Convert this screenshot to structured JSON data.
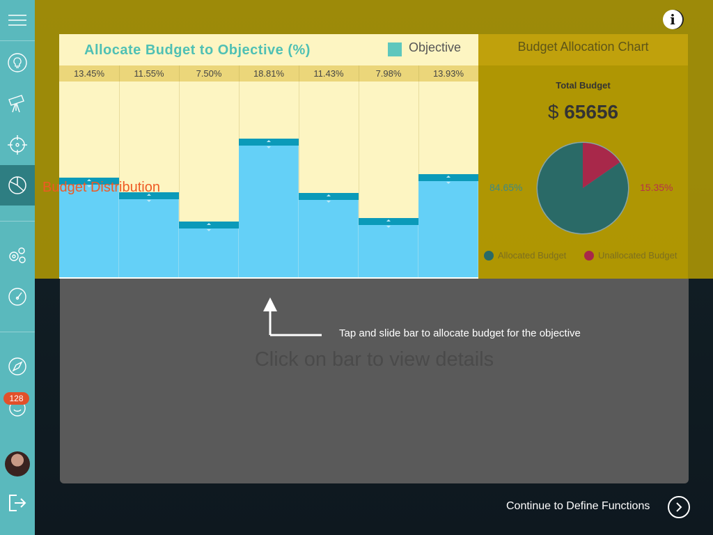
{
  "sidebar": {
    "items": [
      {
        "icon": "menu-icon"
      },
      {
        "icon": "lightbulb-icon"
      },
      {
        "icon": "telescope-icon"
      },
      {
        "icon": "target-icon"
      },
      {
        "icon": "pie-chart-icon",
        "active": true
      },
      {
        "icon": "gears-icon"
      },
      {
        "icon": "speedometer-icon"
      },
      {
        "icon": "compass-icon"
      },
      {
        "icon": "support-icon"
      },
      {
        "icon": "avatar"
      },
      {
        "icon": "logout-icon"
      }
    ],
    "badge": "128",
    "colors": {
      "background": "#5ab9bd",
      "active": "#2e7e82",
      "badge": "#e2502a"
    }
  },
  "info_button": {
    "label": "i"
  },
  "allocation_chart": {
    "title": "Allocate Budget to Objective (%)",
    "legend": "Objective",
    "distribution_label": "Budget Distribution"
  },
  "chart_data": {
    "type": "bar",
    "categories": [
      "",
      "",
      "",
      "",
      "",
      "",
      ""
    ],
    "series": [
      {
        "name": "Objective",
        "values": [
          13.45,
          11.55,
          7.5,
          18.81,
          11.43,
          7.98,
          13.93
        ]
      }
    ],
    "data_labels": [
      "13.45%",
      "11.55%",
      "7.50%",
      "18.81%",
      "11.43%",
      "7.98%",
      "13.93%"
    ],
    "title": "Allocate Budget to Objective (%)",
    "ylim": [
      0,
      26.5
    ],
    "colors": {
      "bar": "#64d0f7",
      "cap": "#0b9ab9",
      "background": "#fdf5c2",
      "legend": "#5ec7bd"
    }
  },
  "pie_chart": {
    "title": "Budget Allocation Chart",
    "total_label": "Total Budget",
    "currency": "$",
    "total_value": "65656",
    "slices": [
      {
        "name": "Allocated Budget",
        "value": 84.65,
        "label": "84.65%",
        "color": "#2a6a67"
      },
      {
        "name": "Unallocated Budget",
        "value": 15.35,
        "label": "15.35%",
        "color": "#a8284a"
      }
    ]
  },
  "details": {
    "placeholder": "Click on bar to view details"
  },
  "hint": {
    "text": "Tap and slide bar to allocate budget for the objective"
  },
  "footer": {
    "continue_label": "Continue to Define Functions"
  }
}
